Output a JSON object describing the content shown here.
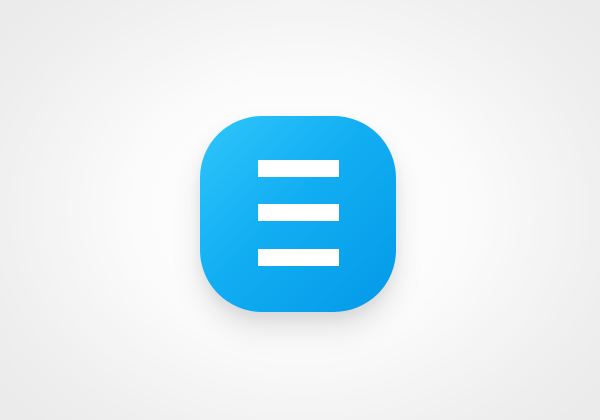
{
  "app_icon": {
    "icon": "hamburger-menu-icon",
    "gradient_colors": [
      "#2fc6fb",
      "#0399e8"
    ],
    "glyph_color": "#ffffff"
  },
  "background": {
    "colors": [
      "#ffffff",
      "#ebebeb"
    ]
  }
}
